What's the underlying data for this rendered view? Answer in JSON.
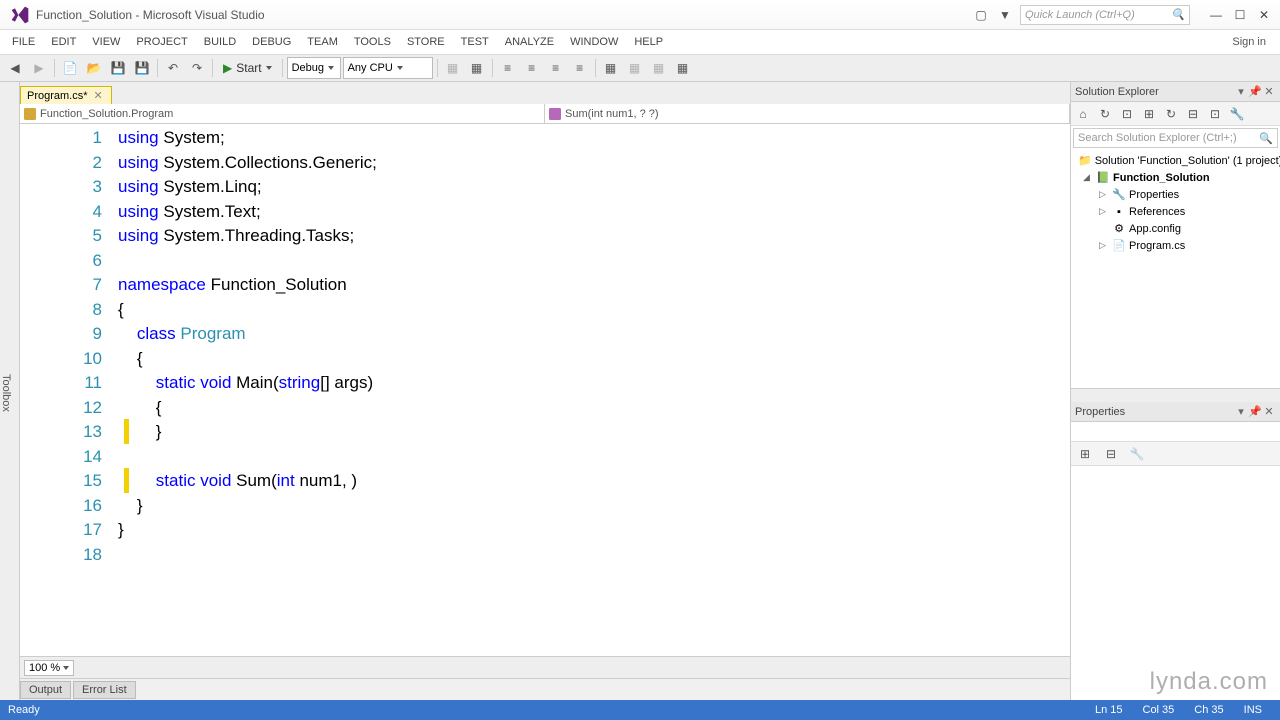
{
  "title": "Function_Solution - Microsoft Visual Studio",
  "quick_launch_placeholder": "Quick Launch (Ctrl+Q)",
  "sign_in": "Sign in",
  "menu": [
    "FILE",
    "EDIT",
    "VIEW",
    "PROJECT",
    "BUILD",
    "DEBUG",
    "TEAM",
    "TOOLS",
    "STORE",
    "TEST",
    "ANALYZE",
    "WINDOW",
    "HELP"
  ],
  "toolbar": {
    "start": "Start",
    "config": "Debug",
    "platform": "Any CPU"
  },
  "toolbox": "Toolbox",
  "tab": {
    "name": "Program.cs*"
  },
  "nav": {
    "left": "Function_Solution.Program",
    "right": "Sum(int num1, ? ?)"
  },
  "code": {
    "lines": [
      {
        "n": "1",
        "html": "<span class='kw'>using</span> System;"
      },
      {
        "n": "2",
        "html": "<span class='kw'>using</span> System.Collections.Generic;"
      },
      {
        "n": "3",
        "html": "<span class='kw'>using</span> System.Linq;"
      },
      {
        "n": "4",
        "html": "<span class='kw'>using</span> System.Text;"
      },
      {
        "n": "5",
        "html": "<span class='kw'>using</span> System.Threading.Tasks;"
      },
      {
        "n": "6",
        "html": ""
      },
      {
        "n": "7",
        "html": "<span class='kw'>namespace</span> Function_Solution"
      },
      {
        "n": "8",
        "html": "{"
      },
      {
        "n": "9",
        "html": "    <span class='kw'>class</span> <span class='type'>Program</span>"
      },
      {
        "n": "10",
        "html": "    {"
      },
      {
        "n": "11",
        "html": "        <span class='kw'>static</span> <span class='kw'>void</span> Main(<span class='kw'>string</span>[] args)"
      },
      {
        "n": "12",
        "html": "        {"
      },
      {
        "n": "13",
        "html": "        }"
      },
      {
        "n": "14",
        "html": ""
      },
      {
        "n": "15",
        "html": "        <span class='kw'>static</span> <span class='kw'>void</span> Sum(<span class='kw'>int</span> num1, )"
      },
      {
        "n": "16",
        "html": "    }"
      },
      {
        "n": "17",
        "html": "}"
      },
      {
        "n": "18",
        "html": ""
      }
    ]
  },
  "zoom": "100 %",
  "bottom_tabs": [
    "Output",
    "Error List"
  ],
  "solution_explorer": {
    "title": "Solution Explorer",
    "search_placeholder": "Search Solution Explorer (Ctrl+;)",
    "root": "Solution 'Function_Solution' (1 project)",
    "project": "Function_Solution",
    "items": [
      "Properties",
      "References",
      "App.config",
      "Program.cs"
    ]
  },
  "properties": {
    "title": "Properties"
  },
  "status": {
    "ready": "Ready",
    "ln": "Ln 15",
    "col": "Col 35",
    "ch": "Ch 35",
    "ins": "INS"
  },
  "watermark": "lynda.com"
}
